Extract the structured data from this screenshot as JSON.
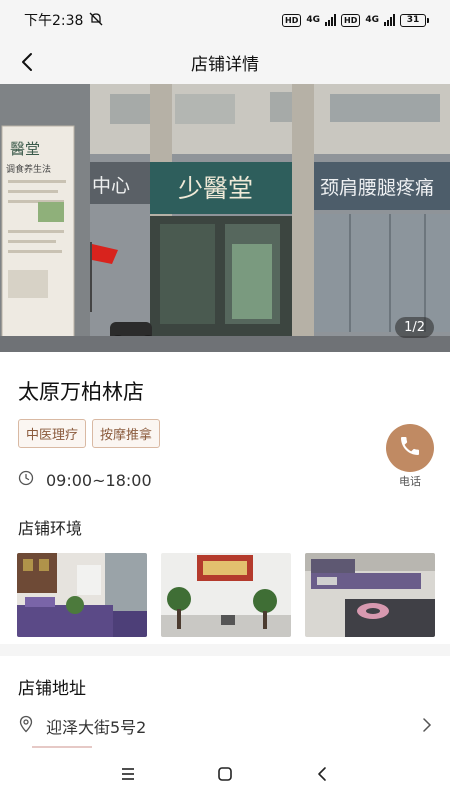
{
  "status": {
    "time": "下午2:38",
    "hd1": "HD",
    "net1": "4G",
    "hd2": "HD",
    "net2": "4G",
    "battery": "31"
  },
  "header": {
    "title": "店铺详情"
  },
  "banner": {
    "indicator": "1/2",
    "signs": {
      "left_sign": "中心",
      "main_sign": "少醫堂",
      "right_sign": "颈肩腰腿疼痛",
      "board_title": "醫堂",
      "board_sub": "调食养生法"
    }
  },
  "store": {
    "name": "太原万柏林店",
    "tags": [
      "中医理疗",
      "按摩推拿"
    ],
    "hours": "09:00~18:00",
    "phone_label": "电话",
    "environment_title": "店铺环境"
  },
  "address": {
    "section_title": "店铺地址",
    "text": "迎泽大街5号2"
  },
  "colors": {
    "accent": "#c08a63",
    "tag_border": "#d9b9a3",
    "tag_text": "#8a5a3c"
  },
  "icons": [
    "back-arrow-icon",
    "mute-icon",
    "phone-icon",
    "clock-icon",
    "location-pin-icon",
    "chevron-right-icon",
    "menu-icon",
    "home-icon",
    "back-icon"
  ]
}
